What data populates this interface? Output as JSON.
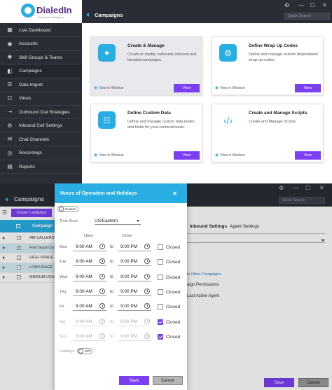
{
  "top": {
    "brand": {
      "name": "DialedIn",
      "tagline": "Powered by Intelligence"
    },
    "sidebar": [
      {
        "label": "Live Dashboard",
        "icon": "dashboard-icon"
      },
      {
        "label": "Accounts",
        "icon": "accounts-icon"
      },
      {
        "label": "Skill Groups & Teams",
        "icon": "teams-icon"
      },
      {
        "label": "Campaigns",
        "icon": "campaigns-icon"
      },
      {
        "label": "Data Import",
        "icon": "data-import-icon"
      },
      {
        "label": "Views",
        "icon": "views-icon"
      },
      {
        "label": "Outbound Dial Strategies",
        "icon": "dial-strategy-icon"
      },
      {
        "label": "Inbound Call Settings",
        "icon": "inbound-settings-icon"
      },
      {
        "label": "Chat Channels",
        "icon": "chat-icon"
      },
      {
        "label": "Recordings",
        "icon": "recordings-icon"
      },
      {
        "label": "Reports",
        "icon": "reports-icon"
      }
    ],
    "header": {
      "title": "Campaigns",
      "search_placeholder": "Quick Search"
    },
    "cards": [
      {
        "title": "Create & Manage",
        "desc": "Create or modify outbound, inbound and blended campaigns.",
        "view_window": "View in Window",
        "view": "View",
        "icon": "magic-wand-icon",
        "color": "#29aee3"
      },
      {
        "title": "Define Wrap Up Codes",
        "desc": "Define and manage custom dispositions/ wrap-up codes.",
        "view_window": "View in Window",
        "view": "View",
        "icon": "folder-gear-icon",
        "color": "#29aee3"
      },
      {
        "title": "Define Custom Data",
        "desc": "Define and manage custom data tables and fields for your contacts/leads.",
        "view_window": "View in Window",
        "view": "View",
        "icon": "custom-data-icon",
        "color": "#29aee3"
      },
      {
        "title": "Create and Manage Scripts",
        "desc": "Create and Manage Scripts.",
        "view_window": "View in Window",
        "view": "View",
        "icon": "code-icon",
        "color": "#29aee3"
      }
    ]
  },
  "bottom": {
    "header": {
      "title": "Campaigns",
      "search_placeholder": "Quick Search"
    },
    "create_label": "Create Campaign",
    "table": {
      "header": "Campaign",
      "rows": [
        {
          "name": "AM-CALLERID",
          "checked": false,
          "selected": false
        },
        {
          "name": "Find Good Cus",
          "checked": true,
          "selected": true
        },
        {
          "name": "HIGH USAGE",
          "checked": false,
          "selected": false
        },
        {
          "name": "LOW USAGE",
          "checked": false,
          "selected": true
        },
        {
          "name": "MEDIUM USAGE",
          "checked": false,
          "selected": false
        }
      ]
    },
    "tabs": [
      "Inbound Settings",
      "Agent Settings"
    ],
    "bg_text": {
      "link": "in Other Campaigns",
      "line1": "aign Permissions",
      "line2": "Last Active Agent"
    },
    "save": "Save",
    "cancel": "Cancel"
  },
  "modal": {
    "title": "Hours of Operation and Holidays",
    "mode_label": "Custom",
    "timezone_label": "Time Zone",
    "timezone": "US/Eastern",
    "open_label": "Open",
    "close_label": "Close",
    "to_label": "to",
    "closed_label": "Closed",
    "days": [
      {
        "day": "Mon",
        "open": "9:00 AM",
        "close": "9:00 PM",
        "closed": false
      },
      {
        "day": "Tue",
        "open": "9:00 AM",
        "close": "9:00 PM",
        "closed": false
      },
      {
        "day": "Wed",
        "open": "9:00 AM",
        "close": "9:00 PM",
        "closed": false
      },
      {
        "day": "Thu",
        "open": "9:00 AM",
        "close": "9:00 PM",
        "closed": false
      },
      {
        "day": "Fri",
        "open": "9:00 AM",
        "close": "9:00 PM",
        "closed": false
      },
      {
        "day": "Sat",
        "open": "9:00 AM",
        "close": "9:00 PM",
        "closed": true
      },
      {
        "day": "Sun",
        "open": "9:00 AM",
        "close": "9:00 PM",
        "closed": true
      }
    ],
    "holidays_label": "Holidays",
    "holidays_toggle": "OFF",
    "save": "Save",
    "cancel": "Cancel"
  }
}
